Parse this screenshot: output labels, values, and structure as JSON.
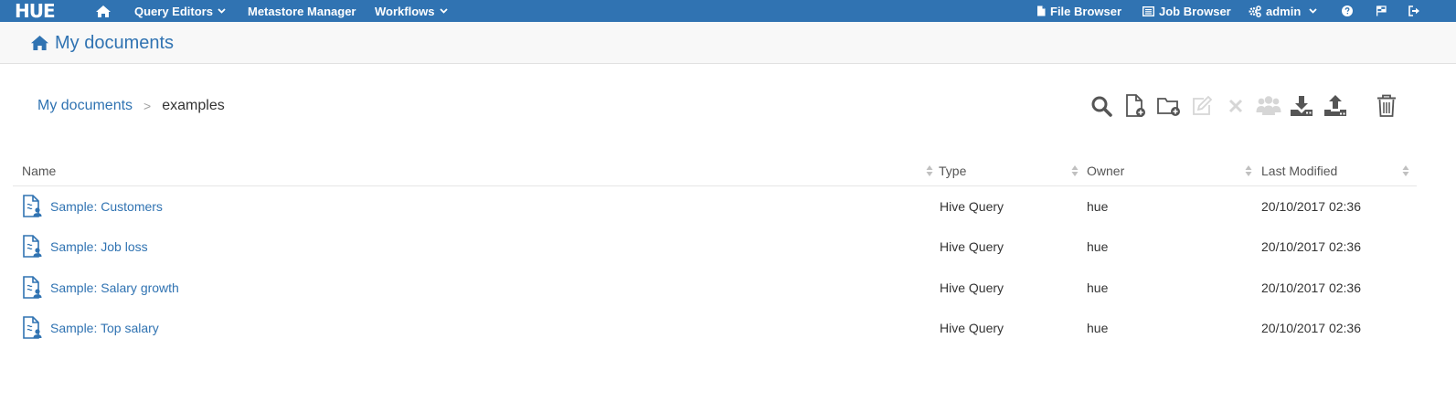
{
  "navbar": {
    "logo": "HUE",
    "query_editors": "Query Editors",
    "metastore_manager": "Metastore Manager",
    "workflows": "Workflows",
    "file_browser": "File Browser",
    "job_browser": "Job Browser",
    "user": "admin"
  },
  "page": {
    "title": "My documents"
  },
  "breadcrumb": {
    "root": "My documents",
    "separator": ">",
    "current": "examples"
  },
  "colors": {
    "brand": "#3073b2",
    "toolbar_icon": "#555555",
    "toolbar_icon_disabled": "#d6d6d6"
  },
  "table": {
    "columns": [
      "Name",
      "Type",
      "Owner",
      "Last Modified"
    ],
    "rows": [
      {
        "name": "Sample: Customers",
        "type": "Hive Query",
        "owner": "hue",
        "modified": "20/10/2017 02:36"
      },
      {
        "name": "Sample: Job loss",
        "type": "Hive Query",
        "owner": "hue",
        "modified": "20/10/2017 02:36"
      },
      {
        "name": "Sample: Salary growth",
        "type": "Hive Query",
        "owner": "hue",
        "modified": "20/10/2017 02:36"
      },
      {
        "name": "Sample: Top salary",
        "type": "Hive Query",
        "owner": "hue",
        "modified": "20/10/2017 02:36"
      }
    ]
  }
}
